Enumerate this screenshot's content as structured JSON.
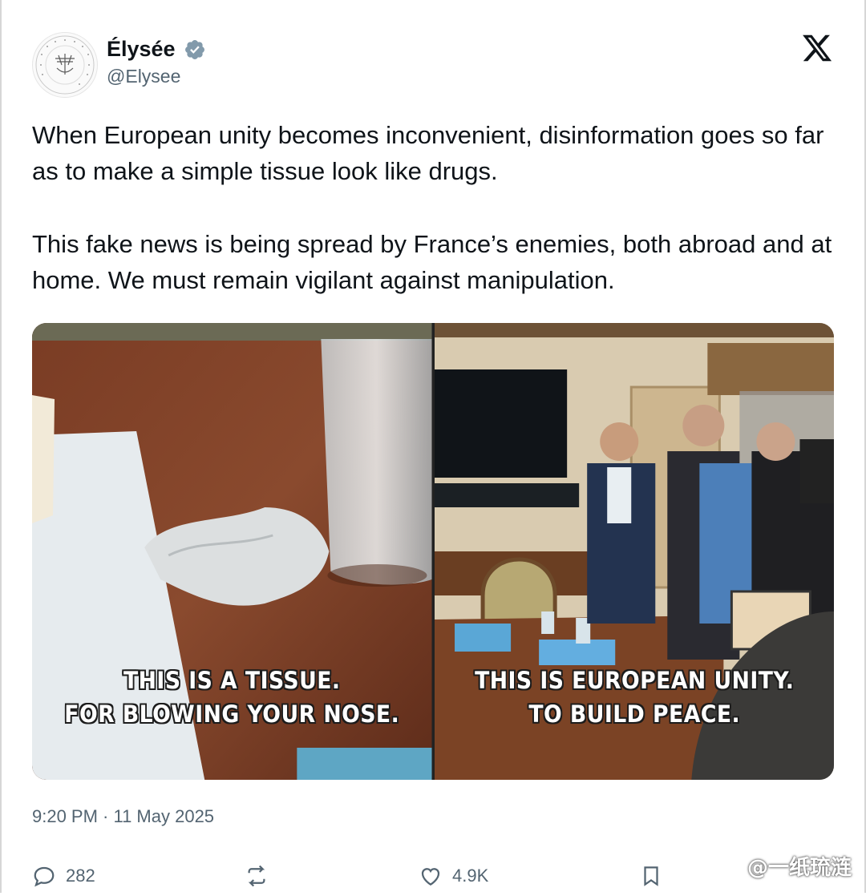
{
  "author": {
    "display_name": "Élysée",
    "handle": "@Elysee",
    "verified": true,
    "avatar_icon": "presidency-seal-icon"
  },
  "platform_icon": "x-logo-icon",
  "tweet": {
    "paragraphs": [
      "When European unity becomes inconvenient, disinformation goes so far as to make a simple tissue look like drugs.",
      "This fake news is being spread by France’s enemies, both abroad and at home. We must remain vigilant against manipulation."
    ],
    "timestamp": "9:20 PM · 11 May 2025"
  },
  "media": {
    "left_image": {
      "caption_line1": "THIS IS A TISSUE.",
      "caption_line2": "FOR BLOWING YOUR NOSE."
    },
    "right_image": {
      "caption_line1": "THIS IS EUROPEAN UNITY.",
      "caption_line2": "TO BUILD PEACE."
    }
  },
  "actions": {
    "replies": "282",
    "likes": "4.9K"
  },
  "watermark": "@一纸琉涟",
  "colors": {
    "text_primary": "#0f1419",
    "text_secondary": "#536471",
    "verified_badge": "#829aab"
  }
}
